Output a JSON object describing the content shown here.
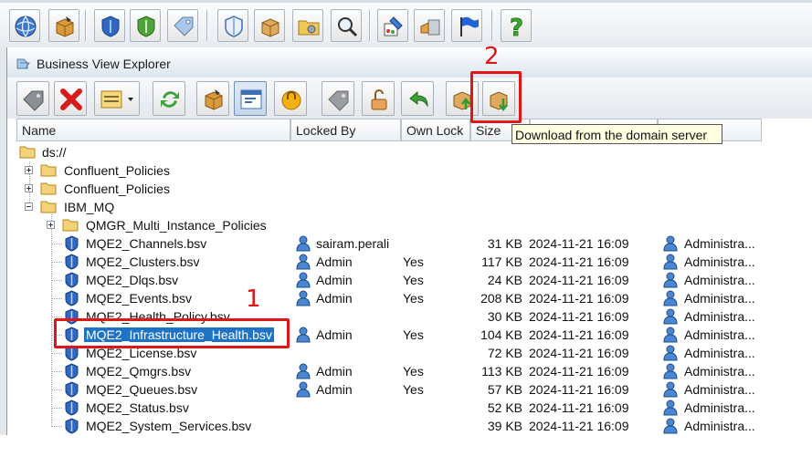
{
  "app_toolbar": {
    "buttons": [
      "globe-icon",
      "package-icon",
      "shield-blue-icon",
      "shield-green-icon",
      "gear-tag-icon",
      "shield-outline-icon",
      "box-icon",
      "gear-folder-icon",
      "search-icon",
      "paint-icon",
      "user-box-icon",
      "flag-icon",
      "help-icon"
    ]
  },
  "window": {
    "title": "Business View Explorer"
  },
  "explorer_toolbar": {
    "buttons": [
      "tag-icon",
      "delete-icon",
      "view-menu-icon",
      "refresh-icon",
      "package-icon",
      "properties-icon",
      "lock-icon",
      "tag-gray-icon",
      "unlock-icon",
      "undo-icon",
      "upload-icon",
      "download-icon"
    ]
  },
  "columns": {
    "name": "Name",
    "locked_by": "Locked By",
    "own_lock": "Own Lock",
    "size": "Size"
  },
  "tooltip": "Download from the domain server",
  "tree": {
    "root": "ds://",
    "folders": [
      "Confluent_Policies",
      "Confluent_Policies",
      "IBM_MQ"
    ],
    "subfolder": "QMGR_Multi_Instance_Policies",
    "files": [
      {
        "name": "MQE2_Channels.bsv",
        "locked_by": "sairam.perali",
        "own_lock": "",
        "size": "31 KB",
        "date": "2024-11-21 16:09",
        "owner": "Administra..."
      },
      {
        "name": "MQE2_Clusters.bsv",
        "locked_by": "Admin",
        "own_lock": "Yes",
        "size": "117 KB",
        "date": "2024-11-21 16:09",
        "owner": "Administra..."
      },
      {
        "name": "MQE2_Dlqs.bsv",
        "locked_by": "Admin",
        "own_lock": "Yes",
        "size": "24 KB",
        "date": "2024-11-21 16:09",
        "owner": "Administra..."
      },
      {
        "name": "MQE2_Events.bsv",
        "locked_by": "Admin",
        "own_lock": "Yes",
        "size": "208 KB",
        "date": "2024-11-21 16:09",
        "owner": "Administra..."
      },
      {
        "name": "MQE2_Health_Policy.bsv",
        "locked_by": "",
        "own_lock": "",
        "size": "30 KB",
        "date": "2024-11-21 16:09",
        "owner": "Administra..."
      },
      {
        "name": "MQE2_Infrastructure_Health.bsv",
        "locked_by": "Admin",
        "own_lock": "Yes",
        "size": "104 KB",
        "date": "2024-11-21 16:09",
        "owner": "Administra..."
      },
      {
        "name": "MQE2_License.bsv",
        "locked_by": "",
        "own_lock": "",
        "size": "72 KB",
        "date": "2024-11-21 16:09",
        "owner": "Administra..."
      },
      {
        "name": "MQE2_Qmgrs.bsv",
        "locked_by": "Admin",
        "own_lock": "Yes",
        "size": "113 KB",
        "date": "2024-11-21 16:09",
        "owner": "Administra..."
      },
      {
        "name": "MQE2_Queues.bsv",
        "locked_by": "Admin",
        "own_lock": "Yes",
        "size": "57 KB",
        "date": "2024-11-21 16:09",
        "owner": "Administra..."
      },
      {
        "name": "MQE2_Status.bsv",
        "locked_by": "",
        "own_lock": "",
        "size": "52 KB",
        "date": "2024-11-21 16:09",
        "owner": "Administra..."
      },
      {
        "name": "MQE2_System_Services.bsv",
        "locked_by": "",
        "own_lock": "",
        "size": "39 KB",
        "date": "2024-11-21 16:09",
        "owner": "Administra..."
      }
    ]
  },
  "annotations": {
    "one": "1",
    "two": "2"
  },
  "colors": {
    "annotation": "#e01616",
    "selection": "#1e73c4",
    "tooltip_bg": "#ffffe1"
  }
}
